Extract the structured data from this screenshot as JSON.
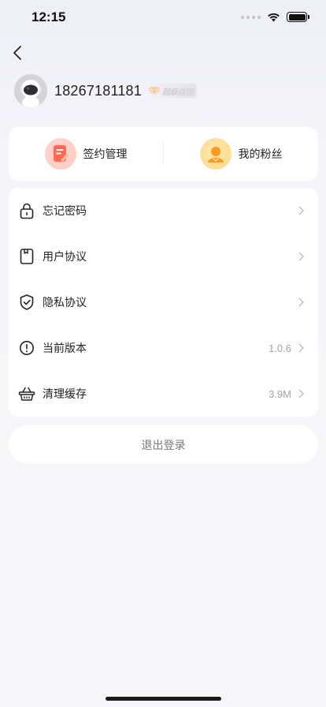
{
  "status_bar": {
    "time": "12:15",
    "icons": [
      "signal-dots-icon",
      "wifi-icon",
      "battery-icon"
    ]
  },
  "header": {
    "back_icon": "chevron-left-icon"
  },
  "profile": {
    "phone": "18267181181",
    "badge_text": "超级店团",
    "avatar_icon": "astronaut-avatar-icon"
  },
  "quick_links": [
    {
      "label": "签约管理",
      "icon": "contract-icon",
      "color": "#ff6a55"
    },
    {
      "label": "我的粉丝",
      "icon": "fans-icon",
      "color": "#ff9a1f"
    }
  ],
  "menu": [
    {
      "label": "忘记密码",
      "icon": "lock-icon",
      "value": ""
    },
    {
      "label": "用户协议",
      "icon": "document-icon",
      "value": ""
    },
    {
      "label": "隐私协议",
      "icon": "shield-check-icon",
      "value": ""
    },
    {
      "label": "当前版本",
      "icon": "info-circle-icon",
      "value": "1.0.6"
    },
    {
      "label": "清理缓存",
      "icon": "basket-icon",
      "value": "3.9M"
    }
  ],
  "logout": {
    "label": "退出登录"
  },
  "colors": {
    "background": "#f6f6f9",
    "card": "#ffffff",
    "muted_text": "#a4a4a8"
  }
}
